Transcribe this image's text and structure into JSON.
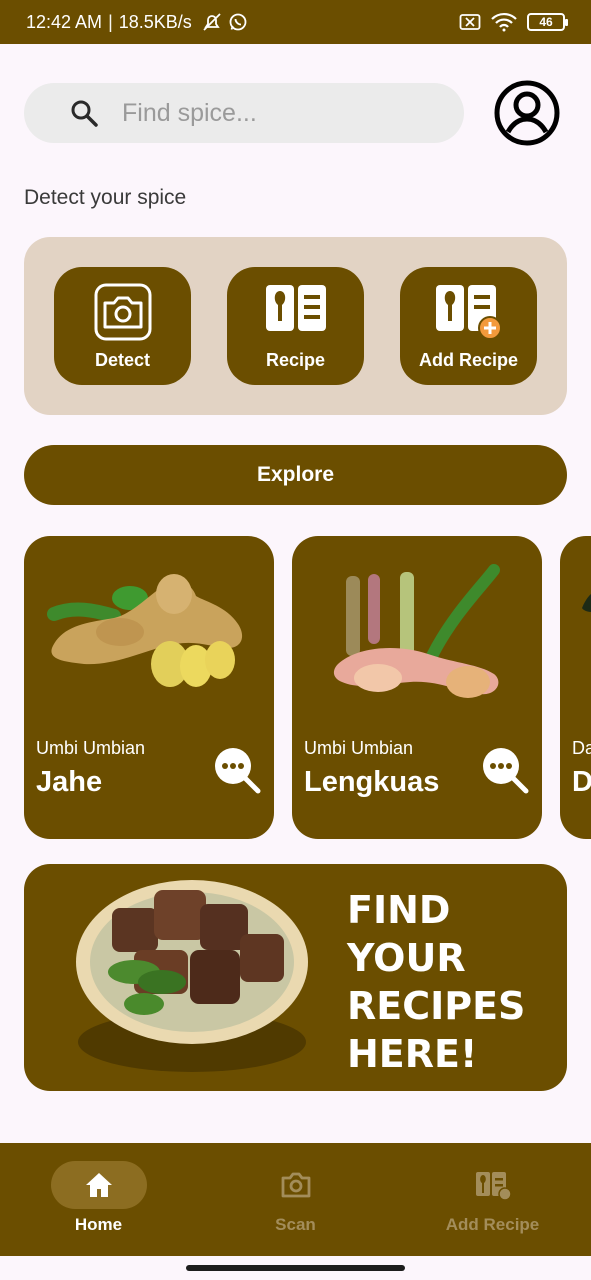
{
  "status_bar": {
    "time": "12:42 AM",
    "separator": "|",
    "speed": "18.5KB/s",
    "battery": "46"
  },
  "search": {
    "placeholder": "Find spice..."
  },
  "section_label": "Detect your spice",
  "actions": [
    {
      "label": "Detect",
      "icon": "camera-icon"
    },
    {
      "label": "Recipe",
      "icon": "recipe-book-icon"
    },
    {
      "label": "Add Recipe",
      "icon": "add-recipe-icon"
    }
  ],
  "explore_label": "Explore",
  "spices": [
    {
      "category": "Umbi Umbian",
      "name": "Jahe"
    },
    {
      "category": "Umbi Umbian",
      "name": "Lengkuas"
    },
    {
      "category": "Da",
      "name": "D"
    }
  ],
  "banner": {
    "line1": "FIND",
    "line2": "YOUR",
    "line3": "RECIPES",
    "line4": "HERE!"
  },
  "nav": [
    {
      "label": "Home",
      "icon": "home-icon",
      "active": true
    },
    {
      "label": "Scan",
      "icon": "camera-icon",
      "active": false
    },
    {
      "label": "Add Recipe",
      "icon": "add-recipe-icon",
      "active": false
    }
  ],
  "colors": {
    "primary": "#6b4e00",
    "panel": "#e2d3c4",
    "background": "#fcf6fc",
    "accent": "#f39a3b"
  }
}
